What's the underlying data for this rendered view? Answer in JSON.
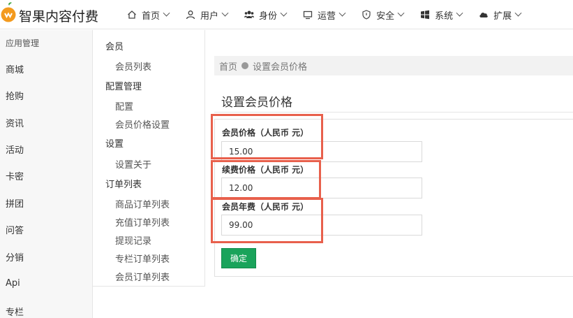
{
  "app": {
    "brand": "智果内容付费"
  },
  "nav": [
    {
      "label": "首页",
      "icon": "home-icon"
    },
    {
      "label": "用户",
      "icon": "user-icon"
    },
    {
      "label": "身份",
      "icon": "group-icon"
    },
    {
      "label": "运营",
      "icon": "monitor-icon"
    },
    {
      "label": "安全",
      "icon": "shield-icon"
    },
    {
      "label": "系统",
      "icon": "windows-icon"
    },
    {
      "label": "扩展",
      "icon": "cloud-icon"
    }
  ],
  "sidebar": {
    "heading": "应用管理",
    "items": [
      "商城",
      "抢购",
      "资讯",
      "活动",
      "卡密",
      "拼团",
      "问答",
      "分销",
      "Api",
      "专栏"
    ]
  },
  "submenu": {
    "groups": [
      {
        "label": "会员",
        "items": [
          "会员列表"
        ]
      },
      {
        "label": "配置管理",
        "items": [
          "配置",
          "会员价格设置"
        ]
      },
      {
        "label": "设置",
        "items": [
          "设置关于"
        ]
      },
      {
        "label": "订单列表",
        "items": [
          "商品订单列表",
          "充值订单列表",
          "提现记录",
          "专栏订单列表",
          "会员订单列表"
        ]
      }
    ]
  },
  "breadcrumb": {
    "home": "首页",
    "current": "设置会员价格"
  },
  "page": {
    "title": "设置会员价格"
  },
  "form": {
    "fields": [
      {
        "label": "会员价格（人民币 元）",
        "value": "15.00"
      },
      {
        "label": "续费价格（人民币 元）",
        "value": "12.00"
      },
      {
        "label": "会员年费（人民币 元）",
        "value": "99.00"
      }
    ],
    "submit_label": "确定"
  },
  "colors": {
    "accent": "#1aa35b",
    "highlight": "#e8604c",
    "logo": "#f39a1e"
  }
}
